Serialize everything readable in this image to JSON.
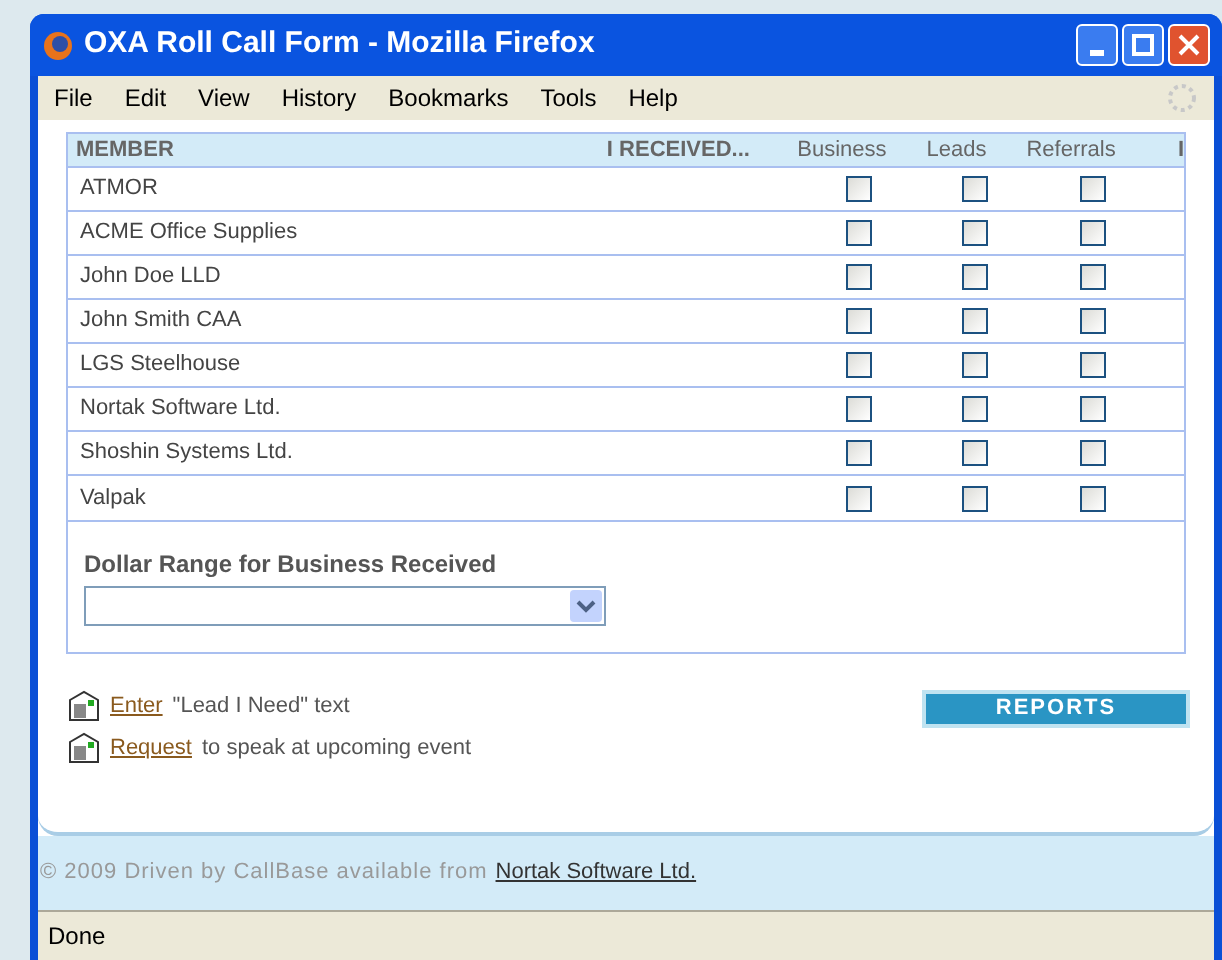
{
  "window": {
    "title": "OXA Roll Call Form - Mozilla Firefox"
  },
  "menu": [
    "File",
    "Edit",
    "View",
    "History",
    "Bookmarks",
    "Tools",
    "Help"
  ],
  "table": {
    "columns": [
      "MEMBER",
      "I RECEIVED...",
      "Business",
      "Leads",
      "Referrals",
      "I"
    ],
    "rows": [
      {
        "member": "ATMOR",
        "business": false,
        "leads": false,
        "referrals": false
      },
      {
        "member": "ACME Office Supplies",
        "business": false,
        "leads": false,
        "referrals": false
      },
      {
        "member": "John Doe LLD",
        "business": false,
        "leads": false,
        "referrals": false
      },
      {
        "member": "John Smith CAA",
        "business": false,
        "leads": false,
        "referrals": false
      },
      {
        "member": "LGS Steelhouse",
        "business": false,
        "leads": false,
        "referrals": false
      },
      {
        "member": "Nortak Software Ltd.",
        "business": false,
        "leads": false,
        "referrals": false
      },
      {
        "member": "Shoshin Systems Ltd.",
        "business": false,
        "leads": false,
        "referrals": false
      },
      {
        "member": "Valpak",
        "business": false,
        "leads": false,
        "referrals": false
      }
    ]
  },
  "dollar_range": {
    "label": "Dollar Range for Business Received"
  },
  "links": [
    {
      "link": "Enter",
      "text": "\"Lead I Need\" text"
    },
    {
      "link": "Request",
      "text": "to speak at upcoming event"
    }
  ],
  "reports_button": "REPORTS",
  "footer": {
    "text": "© 2009 Driven by CallBase available from",
    "link": "Nortak Software Ltd."
  },
  "status_bar": "Done"
}
